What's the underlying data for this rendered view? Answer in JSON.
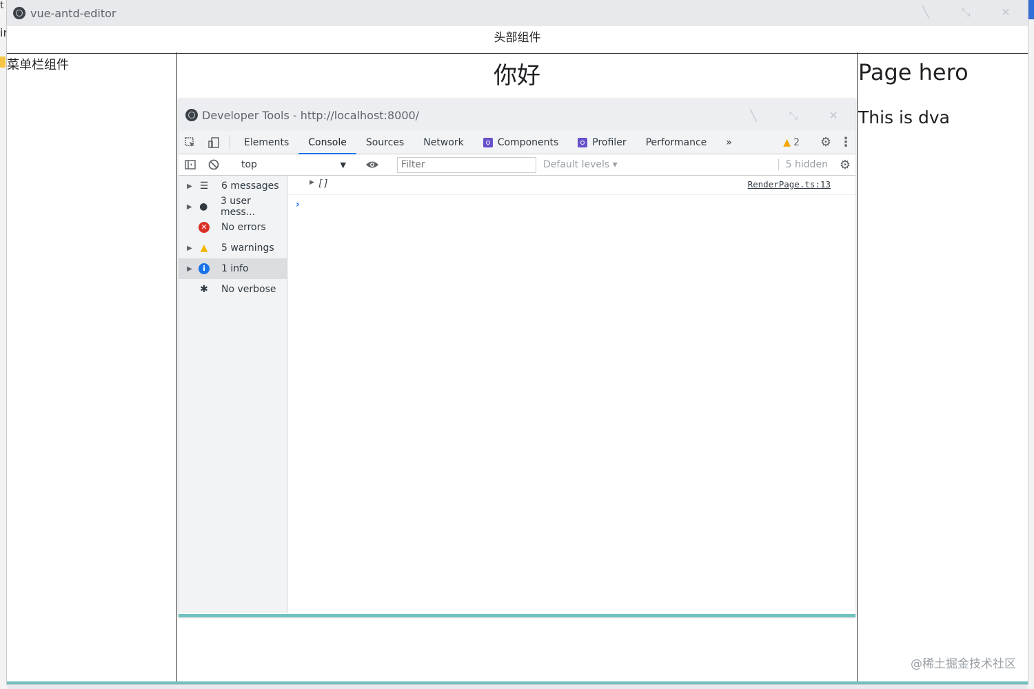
{
  "window": {
    "title": "vue-antd-editor",
    "accent_color": "#6fc2bf"
  },
  "background": {
    "frag_top": "t",
    "frag_mid": "ir"
  },
  "layout": {
    "header_label": "头部组件",
    "sidebar_label": "菜单栏组件",
    "greeting": "你好",
    "page_title": "Page hero",
    "page_subtitle": "This is dva"
  },
  "watermark": "@稀土掘金技术社区",
  "devtools": {
    "title": "Developer Tools - http://localhost:8000/",
    "tabs": [
      {
        "label": "Elements"
      },
      {
        "label": "Console",
        "active": true
      },
      {
        "label": "Sources"
      },
      {
        "label": "Network"
      },
      {
        "label": "Components",
        "icon": "react-icon"
      },
      {
        "label": "Profiler",
        "icon": "react-icon"
      },
      {
        "label": "Performance"
      }
    ],
    "more_tabs": "»",
    "warning_count": "2",
    "toolbar": {
      "context": "top",
      "filter_placeholder": "Filter",
      "levels": "Default levels ▾",
      "hidden": "5 hidden"
    },
    "sidebar": [
      {
        "label": "6 messages",
        "icon": "list-icon",
        "expandable": true
      },
      {
        "label": "3 user mess...",
        "icon": "user-icon",
        "expandable": true
      },
      {
        "label": "No errors",
        "icon": "error-icon",
        "expandable": false
      },
      {
        "label": "5 warnings",
        "icon": "warning-icon",
        "expandable": true
      },
      {
        "label": "1 info",
        "icon": "info-icon",
        "expandable": true,
        "selected": true
      },
      {
        "label": "No verbose",
        "icon": "bug-icon",
        "expandable": false
      }
    ],
    "console": {
      "log_value": "[]",
      "log_source": "RenderPage.ts:13",
      "prompt": "›"
    }
  }
}
